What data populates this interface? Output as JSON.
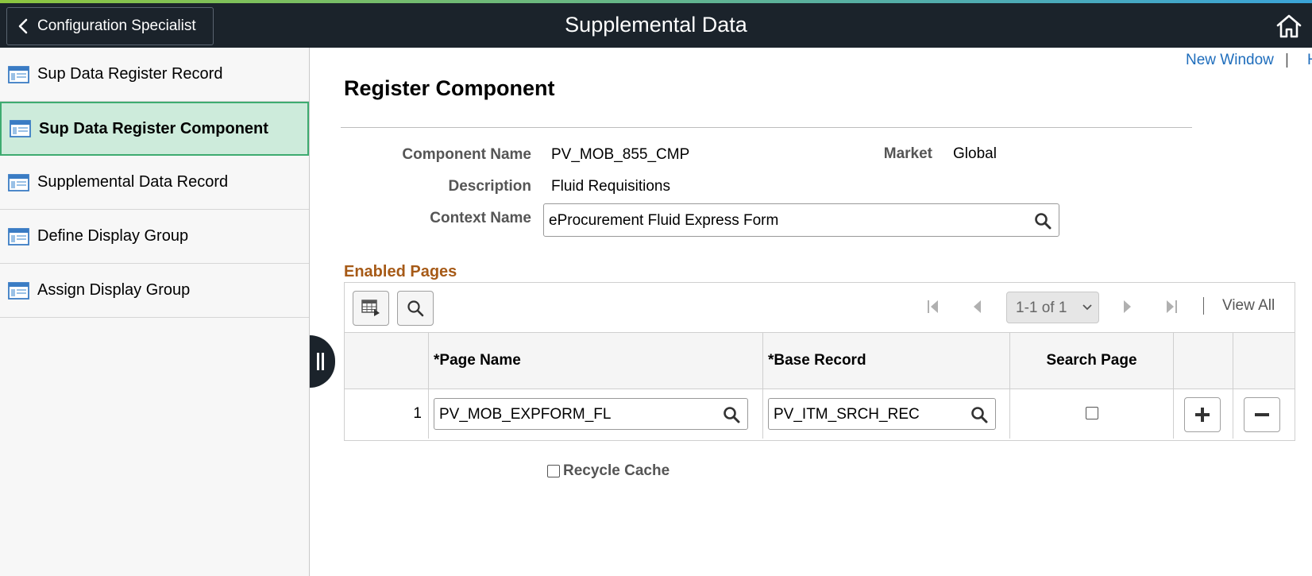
{
  "header": {
    "back_label": "Configuration Specialist",
    "title": "Supplemental Data",
    "home_icon": "home-icon"
  },
  "sidebar": {
    "items": [
      {
        "label": "Sup Data Register Record",
        "icon": "page-icon",
        "active": false
      },
      {
        "label": "Sup Data Register Component",
        "icon": "page-icon",
        "active": true
      },
      {
        "label": "Supplemental Data Record",
        "icon": "page-icon",
        "active": false
      },
      {
        "label": "Define Display Group",
        "icon": "page-icon",
        "active": false
      },
      {
        "label": "Assign Display Group",
        "icon": "page-icon",
        "active": false
      }
    ]
  },
  "links": {
    "new_window": "New Window",
    "separator": "|",
    "more": "H"
  },
  "main": {
    "title": "Register Component",
    "fields": {
      "component_name_label": "Component Name",
      "component_name_value": "PV_MOB_855_CMP",
      "market_label": "Market",
      "market_value": "Global",
      "description_label": "Description",
      "description_value": "Fluid Requisitions",
      "context_name_label": "Context Name",
      "context_name_value": "eProcurement Fluid Express Form"
    },
    "enabled_pages": {
      "title": "Enabled Pages",
      "pager": "1-1 of 1",
      "view_all": "View All",
      "columns": [
        "*Page Name",
        "*Base Record",
        "Search Page"
      ],
      "rows": [
        {
          "num": "1",
          "page_name": "PV_MOB_EXPFORM_FL",
          "base_record": "PV_ITM_SRCH_REC",
          "search_page": false
        }
      ]
    },
    "recycle_cache_label": "Recycle Cache",
    "recycle_cache_checked": false
  },
  "colors": {
    "header_bg": "#1b232b",
    "active_item_bg": "#cdebdb",
    "active_item_border": "#3eab70",
    "section_title": "#a65a17",
    "link": "#1e6dbc"
  }
}
